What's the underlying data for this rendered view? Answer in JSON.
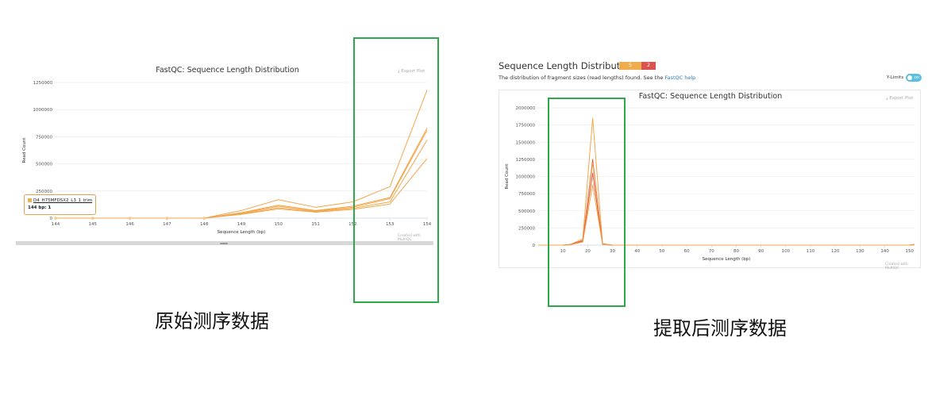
{
  "captions": {
    "left": "原始测序数据",
    "right": "提取后测序数据"
  },
  "left_panel": {
    "export_label": "Export Plot",
    "credit": "Created with MultiQC",
    "tooltip": {
      "sample": "D4_H75MFDSX2_L3_1_trim",
      "value": "144 bp: 1"
    }
  },
  "right_panel": {
    "section_title": "Sequence Length Distribution",
    "badges": [
      "5",
      "2"
    ],
    "description": "The distribution of fragment sizes (read lengths) found. See the",
    "help_link": "FastQC help",
    "ylimits_label": "Y-Limits",
    "toggle_label": "on",
    "export_label": "Export Plot",
    "credit": "Created with MultiQC"
  },
  "colors": {
    "line_orange": "#f2a64a",
    "line_red": "#e0584a",
    "highlight_green": "#2ea84a",
    "badge_orange": "#f0ad4e",
    "badge_red": "#d9534f",
    "toggle_blue": "#5bc0de"
  },
  "chart_data": [
    {
      "type": "line",
      "title": "FastQC: Sequence Length Distribution",
      "xlabel": "Sequence Length (bp)",
      "ylabel": "Read Count",
      "xlim": [
        144,
        154
      ],
      "ylim": [
        0,
        1250000
      ],
      "x_ticks": [
        144,
        145,
        146,
        147,
        148,
        149,
        150,
        151,
        152,
        153,
        154
      ],
      "y_ticks": [
        0,
        250000,
        500000,
        750000,
        1000000,
        1250000
      ],
      "grid": true,
      "series": [
        {
          "x": [
            144,
            148,
            149,
            150,
            151,
            152,
            153,
            154
          ],
          "y": [
            0,
            0,
            70000,
            170000,
            100000,
            150000,
            290000,
            1180000
          ]
        },
        {
          "x": [
            144,
            148,
            149,
            150,
            151,
            152,
            153,
            154
          ],
          "y": [
            0,
            0,
            50000,
            120000,
            70000,
            110000,
            190000,
            830000
          ]
        },
        {
          "x": [
            144,
            148,
            149,
            150,
            151,
            152,
            153,
            154
          ],
          "y": [
            0,
            0,
            45000,
            110000,
            65000,
            100000,
            180000,
            810000
          ]
        },
        {
          "x": [
            144,
            148,
            149,
            150,
            151,
            152,
            153,
            154
          ],
          "y": [
            0,
            0,
            40000,
            95000,
            60000,
            90000,
            150000,
            720000
          ]
        },
        {
          "x": [
            144,
            148,
            149,
            150,
            151,
            152,
            153,
            154
          ],
          "y": [
            0,
            0,
            35000,
            85000,
            55000,
            80000,
            130000,
            550000
          ]
        }
      ]
    },
    {
      "type": "line",
      "title": "FastQC: Sequence Length Distribution",
      "xlabel": "Sequence Length (bp)",
      "ylabel": "Read Count",
      "xlim": [
        0,
        152
      ],
      "ylim": [
        0,
        2000000
      ],
      "x_ticks": [
        10,
        20,
        30,
        40,
        50,
        60,
        70,
        80,
        90,
        100,
        110,
        120,
        130,
        140,
        150
      ],
      "y_ticks": [
        0,
        250000,
        500000,
        750000,
        1000000,
        1250000,
        1500000,
        1750000,
        2000000
      ],
      "grid": true,
      "series": [
        {
          "x": [
            0,
            10,
            13,
            18,
            22,
            26,
            30,
            150,
            152
          ],
          "y": [
            0,
            0,
            10000,
            90000,
            1850000,
            20000,
            0,
            0,
            10000
          ]
        },
        {
          "x": [
            0,
            10,
            13,
            18,
            22,
            26,
            30,
            150,
            152
          ],
          "y": [
            0,
            0,
            8000,
            70000,
            1250000,
            15000,
            0,
            0,
            8000
          ]
        },
        {
          "x": [
            0,
            10,
            13,
            18,
            22,
            26,
            30,
            150,
            152
          ],
          "y": [
            0,
            0,
            7000,
            60000,
            1200000,
            12000,
            0,
            0,
            7000
          ]
        },
        {
          "x": [
            0,
            10,
            13,
            18,
            22,
            26,
            30,
            150,
            152
          ],
          "y": [
            0,
            0,
            6000,
            55000,
            1050000,
            10000,
            0,
            0,
            6000
          ]
        },
        {
          "x": [
            0,
            10,
            13,
            18,
            22,
            26,
            30,
            150,
            152
          ],
          "y": [
            0,
            0,
            5000,
            45000,
            880000,
            8000,
            0,
            0,
            5000
          ]
        }
      ]
    }
  ]
}
